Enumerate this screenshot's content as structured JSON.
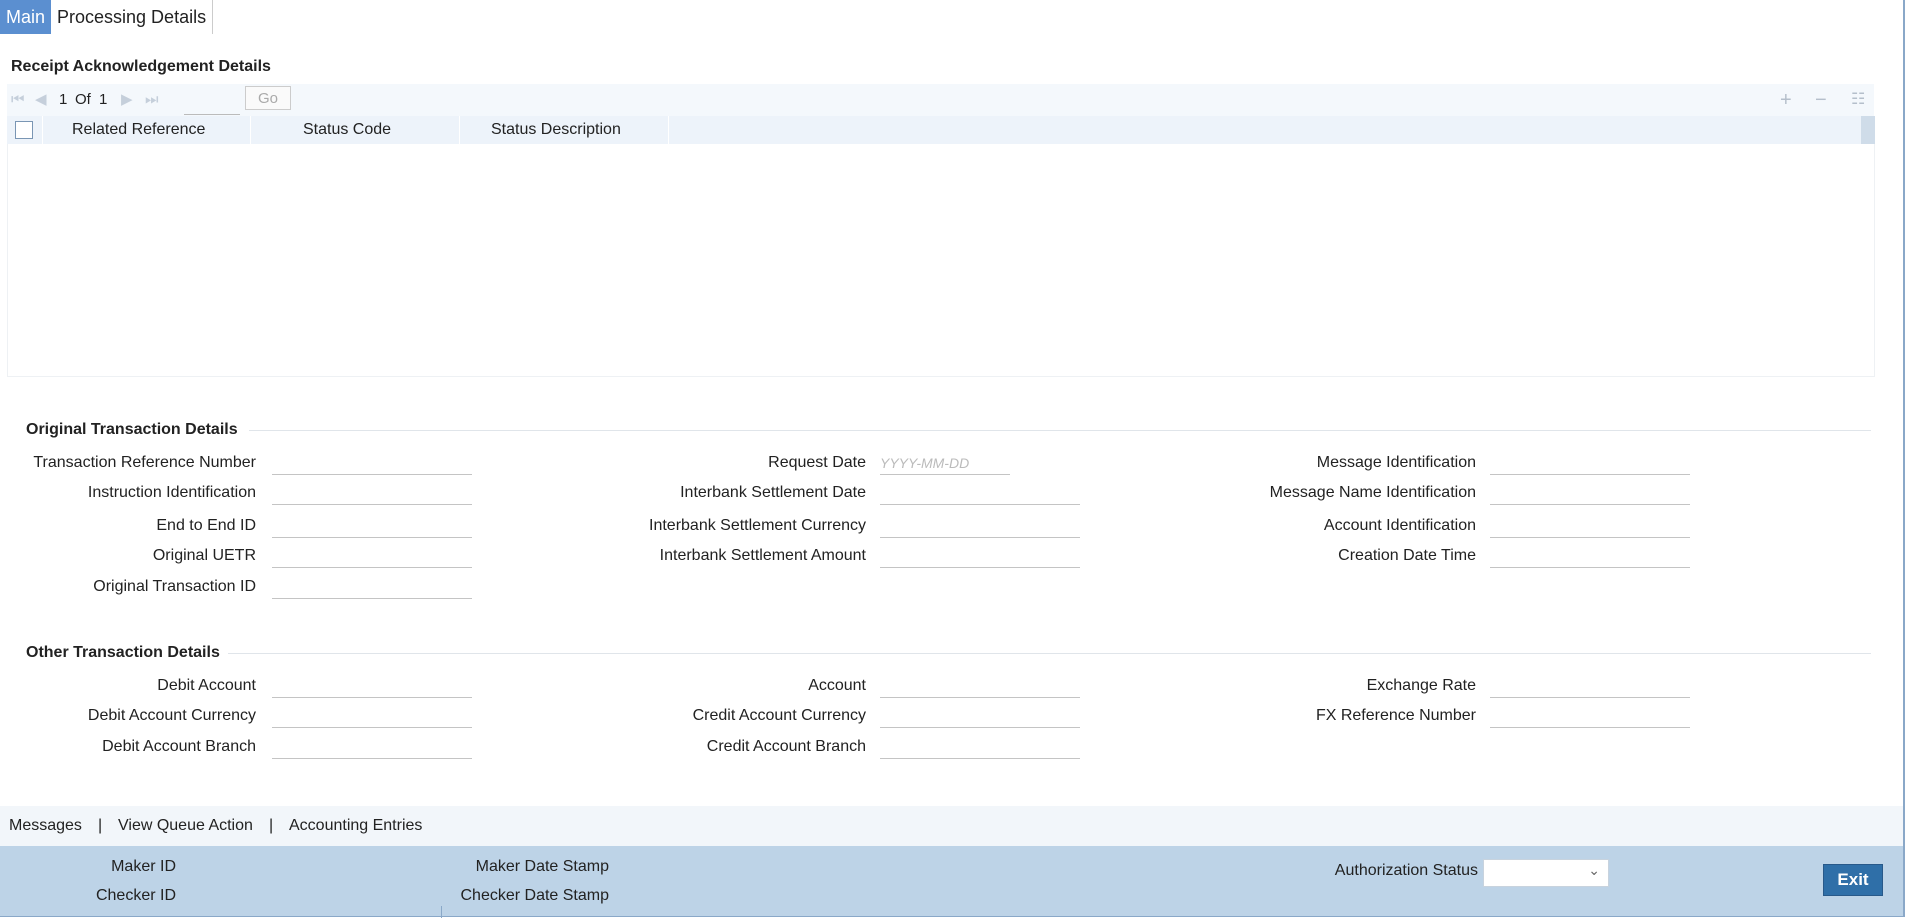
{
  "tabs": [
    {
      "label": "Main",
      "active": true
    },
    {
      "label": "Processing Details",
      "active": false
    }
  ],
  "receipt": {
    "title": "Receipt Acknowledgement Details",
    "pager": {
      "current": "1",
      "of_label": "Of",
      "total": "1",
      "go_label": "Go"
    },
    "columns": [
      "Related Reference",
      "Status Code",
      "Status Description"
    ]
  },
  "original": {
    "title": "Original Transaction Details",
    "col1": [
      "Transaction Reference Number",
      "Instruction Identification",
      "End to End ID",
      "Original UETR",
      "Original Transaction ID"
    ],
    "col2": [
      "Request Date",
      "Interbank Settlement Date",
      "Interbank Settlement Currency",
      "Interbank Settlement Amount"
    ],
    "col3": [
      "Message Identification",
      "Message Name Identification",
      "Account Identification",
      "Creation Date Time"
    ],
    "date_placeholder": "YYYY-MM-DD"
  },
  "other": {
    "title": "Other Transaction Details",
    "col1": [
      "Debit Account",
      "Debit Account Currency",
      "Debit Account Branch"
    ],
    "col2": [
      "Account",
      "Credit Account Currency",
      "Credit Account Branch"
    ],
    "col3": [
      "Exchange Rate",
      "FX Reference Number"
    ]
  },
  "links": [
    "Messages",
    "View Queue Action",
    "Accounting Entries"
  ],
  "link_separator": "|",
  "audit": {
    "maker_id": "Maker ID",
    "checker_id": "Checker ID",
    "maker_date": "Maker Date Stamp",
    "checker_date": "Checker Date Stamp",
    "auth_status": "Authorization Status",
    "exit": "Exit"
  },
  "colors": {
    "accent": "#5b8fd0",
    "audit_bar": "#bdd3e7",
    "exit": "#2f6fa8"
  }
}
